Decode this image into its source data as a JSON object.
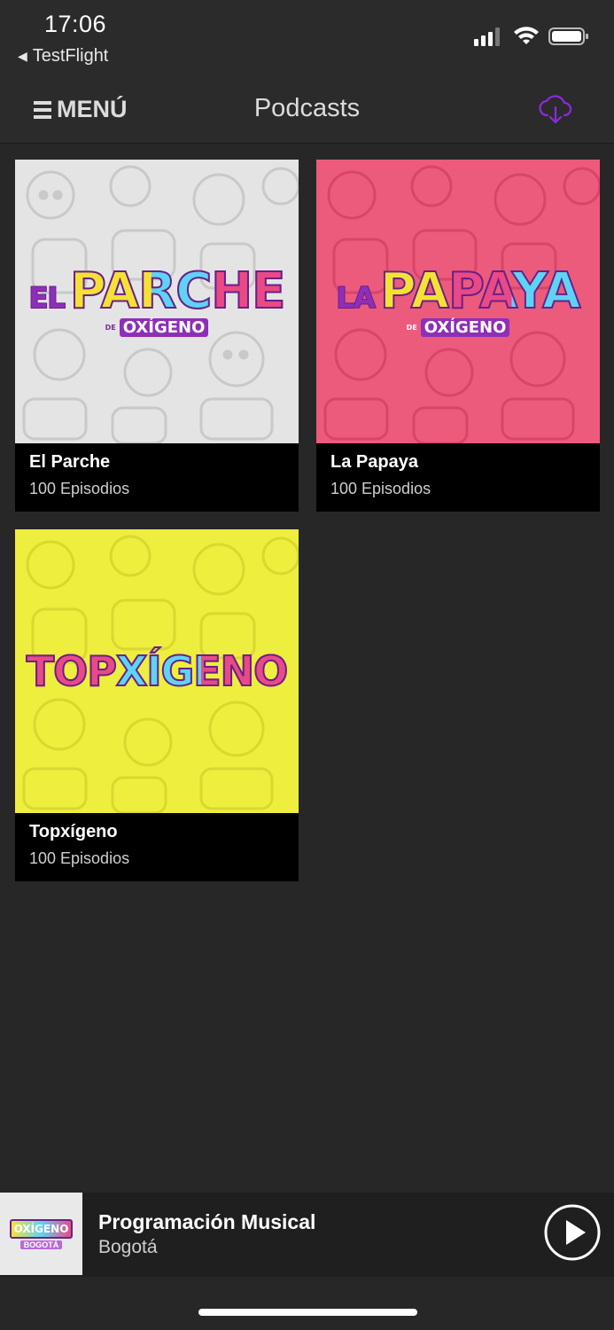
{
  "status_bar": {
    "time": "17:06",
    "back_app": "TestFlight",
    "icons": [
      "cellular-signal-icon",
      "wifi-icon",
      "battery-icon"
    ]
  },
  "nav": {
    "menu_label": "MENÚ",
    "title": "Podcasts",
    "download_icon": "cloud-download-icon",
    "accent_color": "#8a2be2"
  },
  "podcasts": [
    {
      "title": "El Parche",
      "subtitle": "100 Episodios",
      "art": {
        "bg_color": "#e4e4e4",
        "logo_small": "EL",
        "logo_main": "PARCHE",
        "logo_de": "DE",
        "logo_sub": "OXÍGENO"
      }
    },
    {
      "title": "La Papaya",
      "subtitle": "100 Episodios",
      "art": {
        "bg_color": "#ec5b7b",
        "logo_small": "LA",
        "logo_main": "PAPAYA",
        "logo_de": "DE",
        "logo_sub": "OXÍGENO"
      }
    },
    {
      "title": "Topxígeno",
      "subtitle": "100 Episodios",
      "art": {
        "bg_color": "#eeee3e",
        "logo_small": "",
        "logo_main": "TOPXÍGENO",
        "logo_de": "",
        "logo_sub": ""
      }
    }
  ],
  "player": {
    "title": "Programación Musical",
    "subtitle": "Bogotá",
    "thumb_logo": "OXÍGENO",
    "thumb_sub": "BOGOTÁ",
    "play_icon": "play-icon"
  }
}
